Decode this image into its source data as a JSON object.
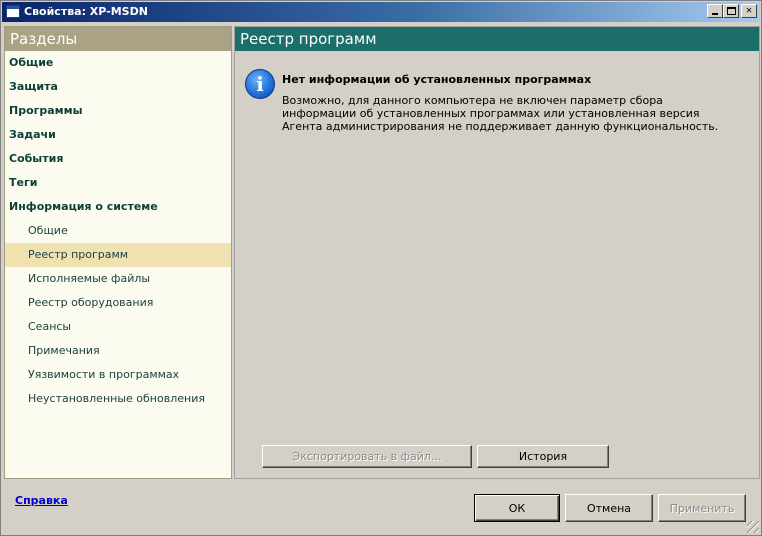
{
  "window": {
    "title": "Свойства: XP-MSDN"
  },
  "nav": {
    "header": "Разделы",
    "items": [
      {
        "label": "Общие",
        "level": 0
      },
      {
        "label": "Защита",
        "level": 0
      },
      {
        "label": "Программы",
        "level": 0
      },
      {
        "label": "Задачи",
        "level": 0
      },
      {
        "label": "События",
        "level": 0
      },
      {
        "label": "Теги",
        "level": 0
      },
      {
        "label": "Информация о системе",
        "level": 0
      },
      {
        "label": "Общие",
        "level": 1
      },
      {
        "label": "Реестр программ",
        "level": 1,
        "active": true
      },
      {
        "label": "Исполняемые файлы",
        "level": 1
      },
      {
        "label": "Реестр оборудования",
        "level": 1
      },
      {
        "label": "Сеансы",
        "level": 1
      },
      {
        "label": "Примечания",
        "level": 1
      },
      {
        "label": "Уязвимости в программах",
        "level": 1
      },
      {
        "label": "Неустановленные обновления",
        "level": 1
      }
    ]
  },
  "content": {
    "header": "Реестр программ",
    "info_icon": "info-icon",
    "info_title": "Нет информации об установленных программах",
    "info_body": "Возможно, для данного компьютера не включен параметр сбора информации об установленных программах или установленная версия Агента администрирования не поддерживает данную функциональность.",
    "export_label": "Экспортировать в файл...",
    "history_label": "История"
  },
  "footer": {
    "help_label": "Справка",
    "ok_label": "ОК",
    "cancel_label": "Отмена",
    "apply_label": "Применить"
  },
  "colors": {
    "nav_header": "#a9a284",
    "content_header": "#1c6e6a",
    "nav_active": "#efe1b0",
    "nav_text": "#0c3f38"
  }
}
